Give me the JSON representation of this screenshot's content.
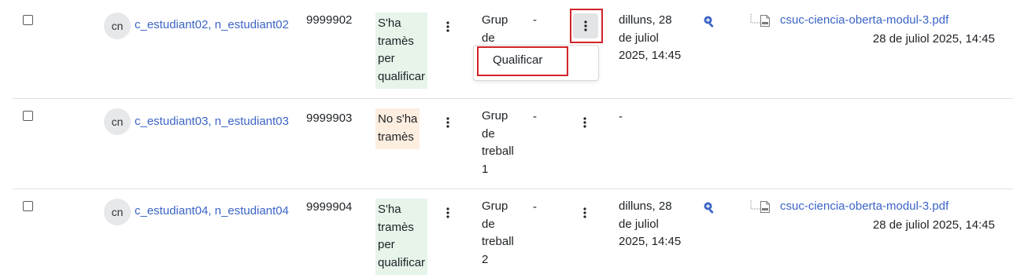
{
  "rows": [
    {
      "initials": "cn",
      "name": "c_estudiant02, n_estudiant02",
      "idnumber": "9999902",
      "status_lines": [
        "S'ha",
        "tramès",
        "per",
        "qualificar"
      ],
      "group_lines": [
        "Grup",
        "de"
      ],
      "grade": "-",
      "modified_lines": [
        "dilluns, 28",
        "de juliol",
        "2025, 14:45"
      ],
      "file_name": "csuc-ciencia-oberta-modul-3.pdf",
      "file_date": "28 de juliol 2025, 14:45"
    },
    {
      "initials": "cn",
      "name": "c_estudiant03, n_estudiant03",
      "idnumber": "9999903",
      "status_lines": [
        "No s'ha",
        "tramès"
      ],
      "group_lines": [
        "Grup",
        "de",
        "treball",
        "1"
      ],
      "grade": "-",
      "modified_lines": [
        "-"
      ]
    },
    {
      "initials": "cn",
      "name": "c_estudiant04, n_estudiant04",
      "idnumber": "9999904",
      "status_lines": [
        "S'ha",
        "tramès",
        "per",
        "qualificar"
      ],
      "group_lines": [
        "Grup",
        "de",
        "treball",
        "2"
      ],
      "grade": "-",
      "modified_lines": [
        "dilluns, 28",
        "de juliol",
        "2025, 14:45"
      ],
      "file_name": "csuc-ciencia-oberta-modul-3.pdf",
      "file_date": "28 de juliol 2025, 14:45"
    }
  ],
  "menu": {
    "grade_label": "Qualificar"
  },
  "icons": {
    "kebab": "kebab-menu-icon",
    "zoom": "zoom-in-icon",
    "file": "pdf-file-icon",
    "tree": "tree-connector-icon"
  },
  "colors": {
    "link": "#3b64c5",
    "status_submitted_bg": "#e6f4ea",
    "status_not_submitted_bg": "#fdeee0",
    "highlight": "#d2232a"
  }
}
